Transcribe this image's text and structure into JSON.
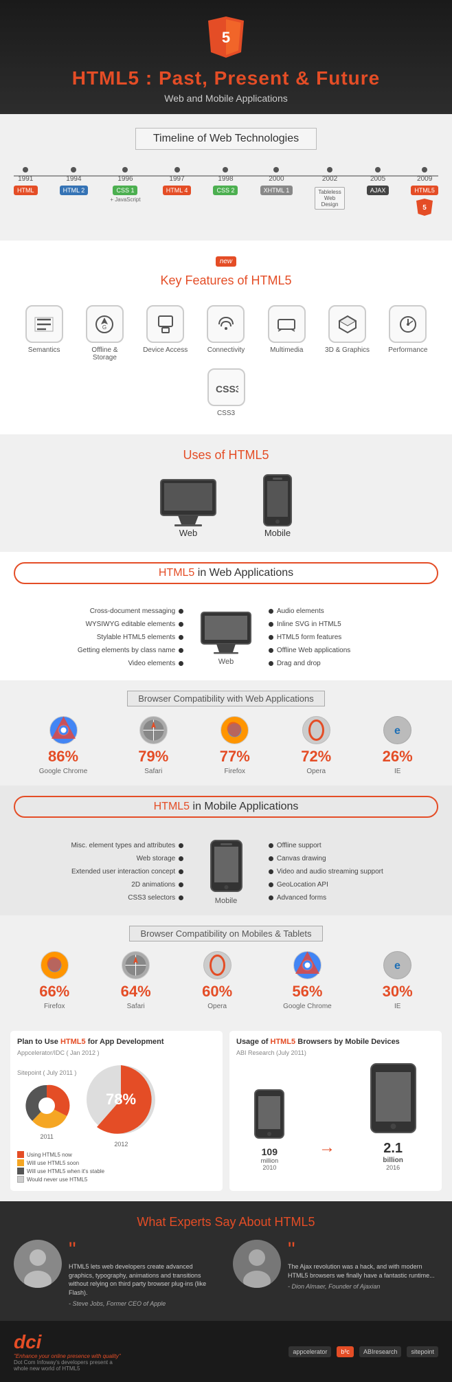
{
  "header": {
    "title_pre": "HTML5 : ",
    "title_main": " Past, Present & Future",
    "subtitle": "Web and Mobile Applications"
  },
  "timeline": {
    "title": "Timeline of Web Technologies",
    "items": [
      {
        "year": "1991",
        "tag": "HTML",
        "color": "orange"
      },
      {
        "year": "1994",
        "tag": "HTML 2",
        "color": "blue"
      },
      {
        "year": "1996",
        "tag": "CSS 1",
        "color": "green",
        "extra": "+ JavaScript"
      },
      {
        "year": "1997",
        "tag": "HTML 4",
        "color": "orange"
      },
      {
        "year": "1998",
        "tag": "CSS 2",
        "color": "green"
      },
      {
        "year": "2000",
        "tag": "XHTML 1",
        "color": "gray"
      },
      {
        "year": "2002",
        "tag": "Tableless Web Design",
        "color": "box"
      },
      {
        "year": "2005",
        "tag": "AJAX",
        "color": "dark"
      },
      {
        "year": "2009",
        "tag": "HTML5",
        "color": "orange"
      }
    ]
  },
  "features": {
    "new_badge": "new",
    "title": "Key Features of",
    "title_highlight": "HTML5",
    "items": [
      {
        "icon": "≡≡",
        "label": "Semantics",
        "unicode": "⊟"
      },
      {
        "icon": "G",
        "label": "Offline & Storage"
      },
      {
        "icon": "▢",
        "label": "Device Access"
      },
      {
        "icon": "↔",
        "label": "Connectivity"
      },
      {
        "icon": "▭",
        "label": "Multimedia"
      },
      {
        "icon": "◈",
        "label": "3D & Graphics"
      },
      {
        "icon": "⚙",
        "label": "Performance"
      },
      {
        "icon": "CSS3",
        "label": "CSS3"
      }
    ]
  },
  "uses": {
    "title": "Uses of",
    "title_highlight": "HTML5",
    "web_label": "Web",
    "mobile_label": "Mobile"
  },
  "web_apps": {
    "section_title": "HTML5 in Web Applications",
    "left_features": [
      "Cross-document messaging",
      "WYSIWYG editable elements",
      "Stylable HTML5 elements",
      "Getting elements by class name",
      "Video elements"
    ],
    "right_features": [
      "Audio elements",
      "Inline SVG in HTML5",
      "HTML5 form features",
      "Offline Web applications",
      "Drag and drop"
    ],
    "center_label": "Web"
  },
  "web_browser_compat": {
    "title": "Browser Compatibility with Web Applications",
    "browsers": [
      {
        "name": "Google Chrome",
        "percent": "86%",
        "icon": "🔵"
      },
      {
        "name": "Safari",
        "percent": "79%",
        "icon": "🔵"
      },
      {
        "name": "Firefox",
        "percent": "77%",
        "icon": "🔵"
      },
      {
        "name": "Opera",
        "percent": "72%",
        "icon": "🔵"
      },
      {
        "name": "IE",
        "percent": "26%",
        "icon": "🔵"
      }
    ]
  },
  "mobile_apps": {
    "section_title": "HTML5 in Mobile Applications",
    "left_features": [
      "Misc. element types and attributes",
      "Web storage",
      "Extended user interaction concept",
      "2D animations",
      "CSS3 selectors"
    ],
    "right_features": [
      "Offline support",
      "Canvas drawing",
      "Video and audio streaming support",
      "GeoLocation API",
      "Advanced forms"
    ],
    "center_label": "Mobile"
  },
  "mobile_browser_compat": {
    "title": "Browser Compatibility on Mobiles & Tablets",
    "browsers": [
      {
        "name": "Firefox",
        "percent": "66%"
      },
      {
        "name": "Safari",
        "percent": "64%"
      },
      {
        "name": "Opera",
        "percent": "60%"
      },
      {
        "name": "Google Chrome",
        "percent": "56%"
      },
      {
        "name": "IE",
        "percent": "30%"
      }
    ]
  },
  "plan_section": {
    "title_pre": "Plan to Use",
    "title_highlight": "HTML5",
    "title_post": "for App Development",
    "source_1": "Sitepoint ( July 2011 )",
    "source_2": "Appcelerator/IDC ( Jan 2012 )",
    "year_2011": "2011",
    "year_2012": "2012",
    "big_percent": "78%",
    "pie_segments_2011": [
      {
        "color": "#e44d26",
        "value": 29,
        "label": "29%"
      },
      {
        "color": "#f5a623",
        "value": 26,
        "label": "26%"
      },
      {
        "color": "#555",
        "value": 45,
        "label": "45%"
      },
      {
        "color": "#ccc",
        "value": 3,
        "label": "3%"
      }
    ],
    "legend": [
      {
        "color": "#e44d26",
        "text": "Using HTML5 now"
      },
      {
        "color": "#f5a623",
        "text": "Will use HTML5 soon"
      },
      {
        "color": "#555",
        "text": "Will use HTML5 when it's stable"
      },
      {
        "color": "#ccc",
        "text": "Would never use HTML5"
      }
    ]
  },
  "usage_section": {
    "title_pre": "Usage of",
    "title_highlight": "HTML5",
    "title_post": "Browsers by Mobile Devices",
    "source": "ABI Research (July 2011)",
    "year_2010": "2010",
    "year_2016": "2016",
    "amount_2010": "109 million",
    "amount_2016": "2.1 billion"
  },
  "experts": {
    "section_title_pre": "What Experts Say About",
    "section_title_highlight": "HTML5",
    "quotes": [
      {
        "text": "HTML5 lets web developers create advanced graphics, typography, animations and transitions without relying on third party browser plug-ins (like Flash).",
        "name": "- Steve Jobs, Former CEO of Apple"
      },
      {
        "text": "The Ajax revolution was a hack, and with modern HTML5 browsers we finally have a fantastic runtime...",
        "name": "- Dion Almaer, Founder of Ajaxian"
      }
    ]
  },
  "footer": {
    "logo": "dci",
    "tagline": "Dot Com Infoway's developers present a whole new world of HTML5",
    "brand_tagline": "\"Enhance your online presence with quality\"",
    "partners": [
      "appcelerator",
      "b3c",
      "ABIresearch",
      "sitepoint"
    ]
  }
}
